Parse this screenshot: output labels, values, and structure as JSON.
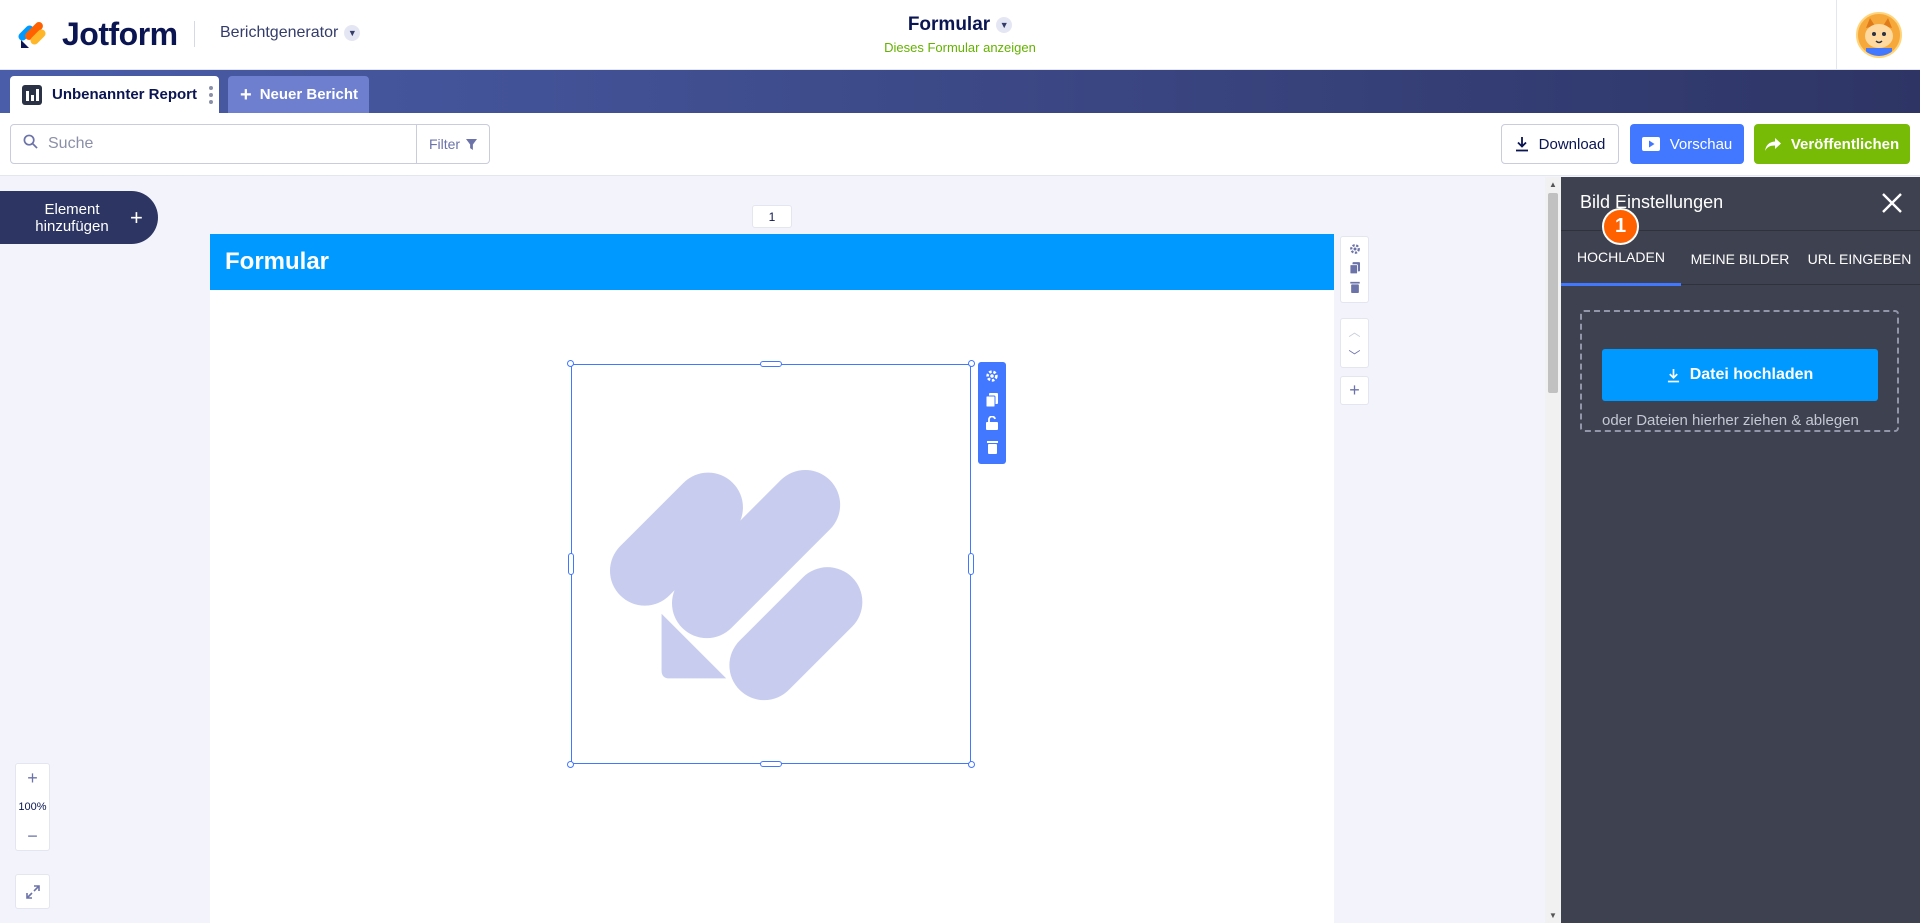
{
  "brand": {
    "name": "Jotform"
  },
  "app_switcher": {
    "label": "Berichtgenerator"
  },
  "form": {
    "title": "Formular",
    "view_link": "Dieses Formular anzeigen"
  },
  "tabs": {
    "report": "Unbenannter Report",
    "new_report": "Neuer Bericht"
  },
  "toolbar": {
    "search_placeholder": "Suche",
    "filter_label": "Filter",
    "download_label": "Download",
    "preview_label": "Vorschau",
    "publish_label": "Veröffentlichen"
  },
  "canvas": {
    "add_element_label": "Element hinzufügen",
    "page_number": "1",
    "page_header": "Formular",
    "zoom_level": "100%"
  },
  "panel": {
    "title": "Bild Einstellungen",
    "tabs": [
      "HOCHLADEN",
      "MEINE BILDER",
      "URL EINGEBEN"
    ],
    "step_badge": "1",
    "upload_button": "Datei hochladen",
    "drop_hint": "oder Dateien hierher ziehen & ablegen"
  },
  "colors": {
    "accent": "#4277ff",
    "header_blue": "#0099ff",
    "publish_green": "#78bb07",
    "panel_bg": "#3e414f",
    "badge_orange": "#ff6100"
  },
  "icons": {
    "search": "search-icon",
    "filter": "filter-icon",
    "download": "download-icon",
    "preview": "play-icon",
    "publish": "share-arrow-icon",
    "close": "close-icon",
    "settings": "gear-icon",
    "duplicate": "copy-icon",
    "lock": "unlock-icon",
    "delete": "trash-icon"
  }
}
